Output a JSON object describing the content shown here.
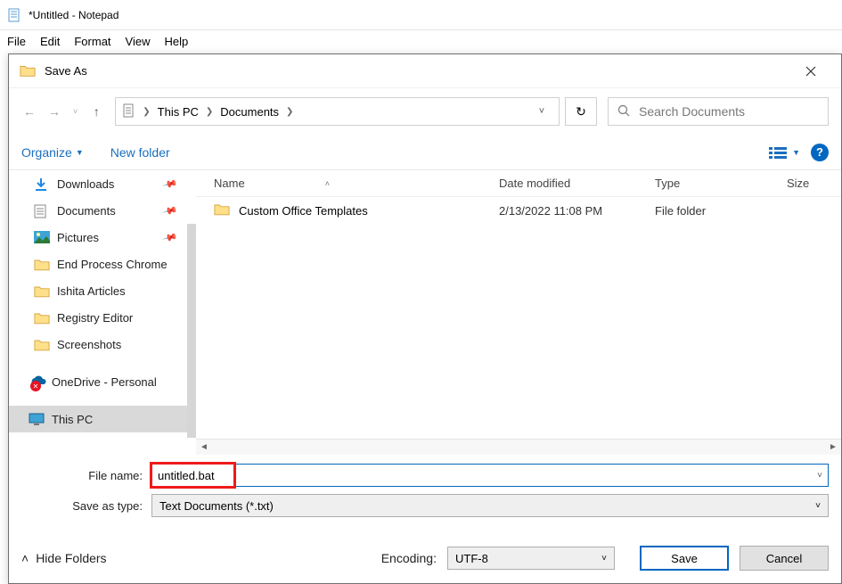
{
  "parent": {
    "title": "*Untitled - Notepad",
    "menu": {
      "file": "File",
      "edit": "Edit",
      "format": "Format",
      "view": "View",
      "help": "Help"
    }
  },
  "dialog": {
    "title": "Save As",
    "address": {
      "root": "This PC",
      "folder": "Documents"
    },
    "search": {
      "placeholder": "Search Documents"
    },
    "toolbar": {
      "organize": "Organize",
      "newfolder": "New folder"
    },
    "columns": {
      "name": "Name",
      "date": "Date modified",
      "type": "Type",
      "size": "Size"
    },
    "rows": [
      {
        "name": "Custom Office Templates",
        "date": "2/13/2022 11:08 PM",
        "type": "File folder",
        "size": ""
      }
    ],
    "sidebar": {
      "items": [
        {
          "label": "Downloads",
          "icon": "download",
          "pinned": true
        },
        {
          "label": "Documents",
          "icon": "document",
          "pinned": true
        },
        {
          "label": "Pictures",
          "icon": "pictures",
          "pinned": true
        },
        {
          "label": "End Process Chrome",
          "icon": "folder",
          "pinned": false
        },
        {
          "label": "Ishita Articles",
          "icon": "folder",
          "pinned": false
        },
        {
          "label": "Registry Editor",
          "icon": "folder",
          "pinned": false
        },
        {
          "label": "Screenshots",
          "icon": "folder",
          "pinned": false
        }
      ],
      "onedrive": "OneDrive - Personal",
      "thispc": "This PC"
    },
    "filename_label": "File name:",
    "filename_value": "untitled.bat",
    "savetype_label": "Save as type:",
    "savetype_value": "Text Documents (*.txt)",
    "hide_folders": "Hide Folders",
    "encoding_label": "Encoding:",
    "encoding_value": "UTF-8",
    "buttons": {
      "save": "Save",
      "cancel": "Cancel"
    }
  }
}
